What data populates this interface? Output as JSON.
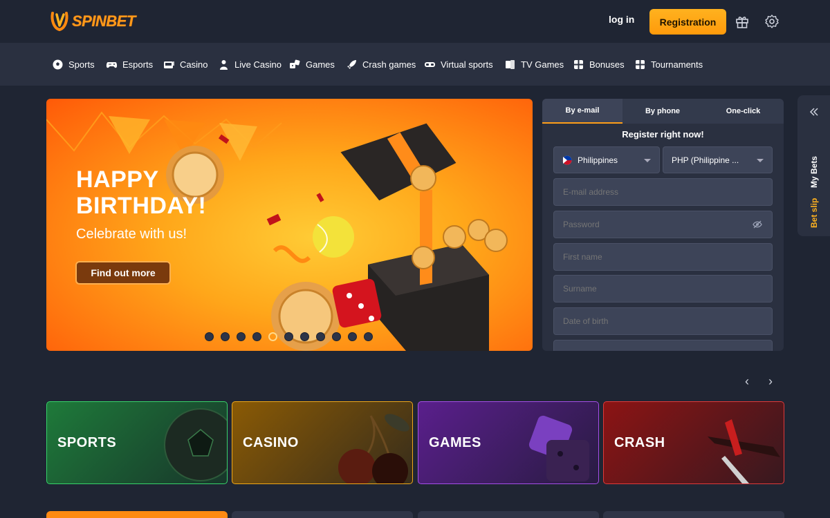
{
  "header": {
    "logo_text": "SPINBET",
    "login_label": "log in",
    "registration_label": "Registration",
    "icons": [
      "gift-icon",
      "gear-icon"
    ]
  },
  "nav": {
    "items": [
      {
        "label": "Sports",
        "icon": "soccer-ball-icon"
      },
      {
        "label": "Esports",
        "icon": "gamepad-icon"
      },
      {
        "label": "Casino",
        "icon": "slot-icon"
      },
      {
        "label": "Live Casino",
        "icon": "dealer-icon"
      },
      {
        "label": "Games",
        "icon": "dice-icon"
      },
      {
        "label": "Crash games",
        "icon": "rocket-icon"
      },
      {
        "label": "Virtual sports",
        "icon": "vr-headset-icon"
      },
      {
        "label": "TV Games",
        "icon": "cards-icon"
      },
      {
        "label": "Bonuses",
        "icon": "gift-box-icon"
      },
      {
        "label": "Tournaments",
        "icon": "trophy-icon"
      }
    ]
  },
  "banner": {
    "title_line1": "HAPPY",
    "title_line2": "BIRTHDAY!",
    "subtitle": "Celebrate with us!",
    "cta_label": "Find out more",
    "slide_count": 11,
    "active_slide": 5
  },
  "registration": {
    "tabs": [
      "By e-mail",
      "By phone",
      "One-click"
    ],
    "active_tab": 0,
    "title": "Register right now!",
    "country": "Philippines",
    "currency": "PHP (Philippine ...",
    "fields": [
      {
        "placeholder": "E-mail address"
      },
      {
        "placeholder": "Password"
      },
      {
        "placeholder": "First name"
      },
      {
        "placeholder": "Surname"
      },
      {
        "placeholder": "Date of birth"
      }
    ]
  },
  "side_panel": {
    "bet_slip_label": "Bet slip",
    "my_bets_label": "My Bets",
    "collapse_icon": "double-chevron-left-icon"
  },
  "categories": [
    {
      "label": "SPORTS",
      "color": "#1e7a3a",
      "border": "#37d46a"
    },
    {
      "label": "CASINO",
      "color": "#8a5a05",
      "border": "#f0a818"
    },
    {
      "label": "GAMES",
      "color": "#5a1f8c",
      "border": "#a54ee8"
    },
    {
      "label": "CRASH",
      "color": "#8c1414",
      "border": "#e03a3a"
    }
  ],
  "colors": {
    "accent": "#ff9e18",
    "background": "#1f2533",
    "panel": "#2a3040"
  }
}
